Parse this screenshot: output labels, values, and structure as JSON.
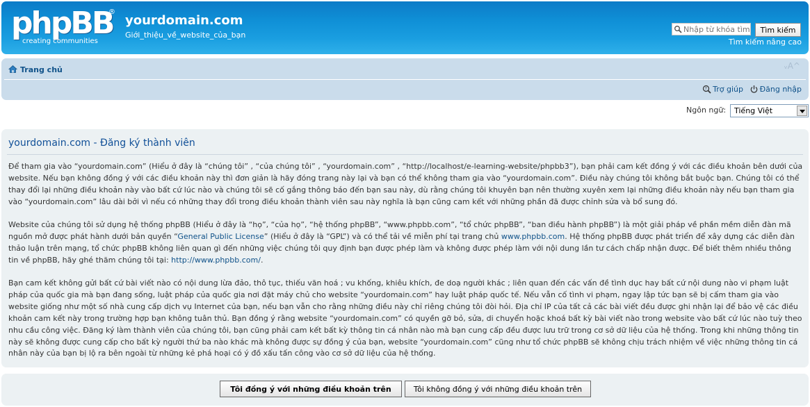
{
  "header": {
    "logo_text": "phpBB",
    "logo_tagline": "creating communities",
    "site_title": "yourdomain.com",
    "site_description": "Giới_thiệu_về_website_của_bạn",
    "search_placeholder": "Nhập từ khóa tìm",
    "search_button": "Tìm kiếm",
    "advanced_search": "Tìm kiếm nâng cao"
  },
  "navbar": {
    "home": "Trang chủ",
    "font_size": "ᵥA^",
    "help": "Trợ giúp",
    "login": "Đăng nhập"
  },
  "language": {
    "label": "Ngôn ngữ:",
    "selected": "Tiếng Việt"
  },
  "panel": {
    "title": "yourdomain.com - Đăng ký thành viên",
    "p1": "Để tham gia vào “yourdomain.com” (Hiểu ở đây là “chúng tôi” , “của chúng tôi” , “yourdomain.com” , “http://localhost/e-learning-website/phpbb3”), bạn phải cam kết đồng ý với các điều khoản bên dưới của website. Nếu bạn không đồng ý với các điều khoản này thì đơn giản là hãy đóng trang này lại và bạn có thể không tham gia vào “yourdomain.com”. Điều này chúng tôi không bắt buộc bạn. Chúng tôi có thể thay đổi lại những điều khoản này vào bất cứ lúc nào và chúng tôi sẽ cố gắng thông báo đến bạn sau này, dù rằng chúng tôi khuyên bạn nên thường xuyên xem lại những điều khoản này nếu bạn tham gia vào “yourdomain.com” lâu dài bởi vì nếu có những thay đổi trong điều khoản thành viên sau này nghĩa là bạn cũng cam kết với những phần đã được chỉnh sửa và bổ sung đó.",
    "p2_a": "Website của chúng tôi sử dụng hệ thống phpBB (Hiểu ở đây là “họ”, “của họ”, “hệ thống phpBB”, “www.phpbb.com”, “tổ chức phpBB”, “ban điều hành phpBB”) là một giải pháp về phần mềm diễn đàn mã nguồn mở được phát hành dưới bản quyền “",
    "p2_link1": "General Public License",
    "p2_b": "” (Hiểu ở đây là “GPL”) và có thể tải về miễn phí tại trang chủ ",
    "p2_link2": "www.phpbb.com",
    "p2_c": ". Hệ thống phpBB được phát triển để xây dựng các diễn đàn thảo luận trên mạng, tổ chức phpBB không liên quan gì đến những việc chúng tôi quy định bạn được phép làm và không được phép làm với nội dung lần tư cách chấp nhận được. Để biết thêm nhiều thông tin về phpBB, hãy ghé thăm chúng tôi tại: ",
    "p2_link3": "http://www.phpbb.com/",
    "p2_d": ".",
    "p3": "Bạn cam kết không gửi bất cứ bài viết nào có nội dung lừa đảo, thô tục, thiếu văn hoá ; vu khống, khiêu khích, đe doạ người khác ; liên quan đến các vấn đề tình dục hay bất cứ nội dung nào vi phạm luật pháp của quốc gia mà bạn đang sống, luật pháp của quốc gia nơi đặt máy chủ cho website “yourdomain.com” hay luật pháp quốc tế. Nếu vẫn cố tình vi phạm, ngay lập tức bạn sẽ bị cấm tham gia vào website giống như một số nhà cung cấp dịch vụ Internet của bạn, nếu bạn vẫn cho rằng những điều này chỉ riêng chúng tôi đòi hỏi. Địa chỉ IP của tất cả các bài viết đều được ghi nhận lại để bảo vệ các điều khoản cam kết này trong trường hợp bạn không tuân thủ. Bạn đồng ý rằng website “yourdomain.com” có quyền gỡ bỏ, sửa, di chuyển hoặc khoá bất kỳ bài viết nào trong website vào bất cứ lúc nào tuỳ theo nhu cầu công việc. Đăng ký làm thành viên của chúng tôi, bạn cũng phải cam kết bất kỳ thông tin cá nhân nào mà bạn cung cấp đều được lưu trữ trong cơ sở dữ liệu của hệ thống. Trong khi những thông tin này sẽ không được cung cấp cho bất kỳ người thứ ba nào khác mà không được sự đồng ý của bạn, website “yourdomain.com” cũng như tổ chức phpBB sẽ không chịu trách nhiệm về việc những thông tin cá nhân này của bạn bị lộ ra bên ngoài từ những kẻ phá hoại có ý đồ xấu tấn công vào cơ sở dữ liệu của hệ thống."
  },
  "buttons": {
    "agree": "Tôi đồng ý với những điều khoản trên",
    "disagree": "Tôi không đồng ý với những điều khoản trên"
  }
}
